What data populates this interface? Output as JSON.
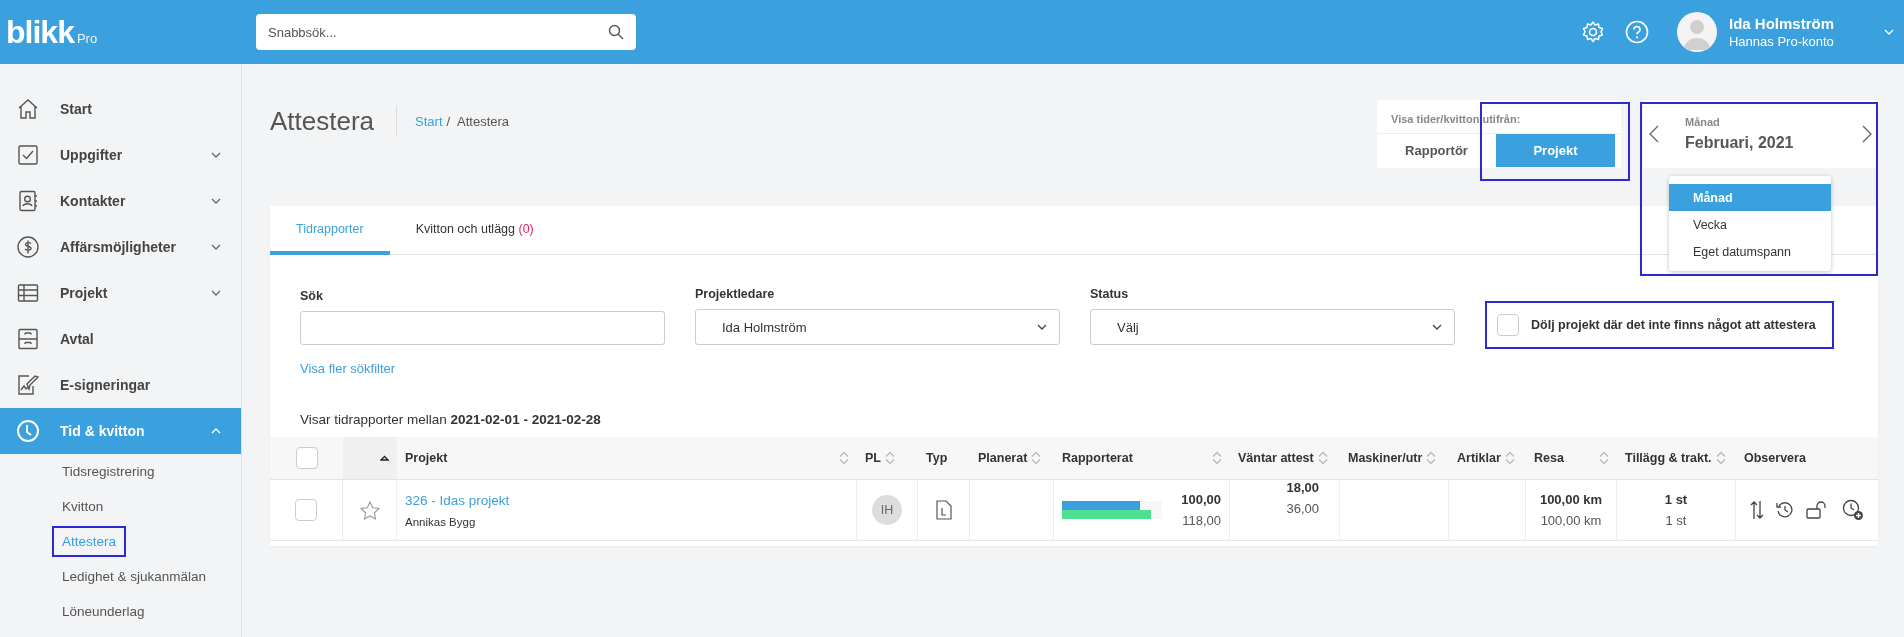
{
  "topbar": {
    "logo": "blikk",
    "logo_suffix": "Pro",
    "search": {
      "placeholder": "Snabbsök..."
    },
    "user": {
      "name": "Ida Holmström",
      "account": "Hannas Pro-konto"
    }
  },
  "sidebar": {
    "items": [
      {
        "label": "Start",
        "kind": "link",
        "selected": false
      },
      {
        "label": "Uppgifter",
        "kind": "group",
        "expanded": false,
        "selected": false
      },
      {
        "label": "Kontakter",
        "kind": "group",
        "expanded": false,
        "selected": false
      },
      {
        "label": "Affärsmöjligheter",
        "kind": "group",
        "expanded": false,
        "selected": false
      },
      {
        "label": "Projekt",
        "kind": "group",
        "expanded": false,
        "selected": false
      },
      {
        "label": "Avtal",
        "kind": "link",
        "selected": false
      },
      {
        "label": "E-signeringar",
        "kind": "link",
        "selected": false
      },
      {
        "label": "Tid & kvitton",
        "kind": "group",
        "expanded": true,
        "selected": true,
        "children": [
          {
            "label": "Tidsregistrering",
            "selected": false,
            "highlighted": false
          },
          {
            "label": "Kvitton",
            "selected": false,
            "highlighted": false
          },
          {
            "label": "Attestera",
            "selected": true,
            "highlighted": true
          },
          {
            "label": "Ledighet & sjukanmälan",
            "selected": false,
            "highlighted": false
          },
          {
            "label": "Löneunderlag",
            "selected": false,
            "highlighted": false
          }
        ]
      }
    ]
  },
  "page": {
    "title": "Attestera",
    "separator": "/",
    "breadcrumb": [
      {
        "label": "Start",
        "kind": "link"
      },
      {
        "label": "Attestera",
        "kind": "current"
      }
    ]
  },
  "view_toggle": {
    "label": "Visa tider/kvitton utifrån:",
    "highlighted": true,
    "options": [
      {
        "label": "Rapportör",
        "selected": false
      },
      {
        "label": "Projekt",
        "selected": true
      }
    ]
  },
  "period": {
    "label": "Månad",
    "value": "Februari, 2021",
    "highlighted": true,
    "options": [
      {
        "label": "Månad",
        "selected": true
      },
      {
        "label": "Vecka",
        "selected": false
      },
      {
        "label": "Eget datumspann",
        "selected": false
      }
    ]
  },
  "tabs": [
    {
      "label": "Tidrapporter",
      "selected": true
    },
    {
      "label": "Kvitton och utlägg",
      "count": "(0)",
      "selected": false
    }
  ],
  "filters": {
    "search": {
      "label": "Sök"
    },
    "project_manager": {
      "label": "Projektledare",
      "value": "Ida Holmström"
    },
    "status": {
      "label": "Status",
      "value": "Välj"
    },
    "hide_empty": {
      "label": "Dölj projekt där det inte finns något att attestera",
      "checked": false,
      "highlighted": true
    },
    "more_link": "Visa fler sökfilter"
  },
  "range_text": "Visar tidrapporter mellan **2021-02-01 - 2021-02-28**",
  "table": {
    "select_all": {
      "checked": false
    },
    "columns": [
      {
        "label": "Projekt",
        "sortable": true
      },
      {
        "label": "PL",
        "sortable": true
      },
      {
        "label": "Typ",
        "sortable": false
      },
      {
        "label": "Planerat",
        "sortable": true
      },
      {
        "label": "Rapporterat",
        "sortable": true
      },
      {
        "label": "Väntar attest",
        "sortable": true
      },
      {
        "label": "Maskiner/utr",
        "sortable": true
      },
      {
        "label": "Artiklar",
        "sortable": true
      },
      {
        "label": "Resa",
        "sortable": true
      },
      {
        "label": "Tillägg & trakt.",
        "sortable": true
      },
      {
        "label": "Observera",
        "sortable": false
      }
    ],
    "rows": [
      {
        "checked": false,
        "starred": false,
        "project": "326 - Idas projekt",
        "customer": "Annikas Bygg",
        "pl": "IH",
        "bars": [
          {
            "level": 0.78,
            "color": "#3aa0de"
          },
          {
            "level": 0.89,
            "color": "#4fe08f"
          }
        ],
        "reported": [
          "100,00",
          "118,00"
        ],
        "waiting": [
          "18,00",
          "36,00"
        ],
        "travel": [
          "100,00 km",
          "100,00 km"
        ],
        "extras": [
          "1 st",
          "1 st"
        ]
      }
    ]
  }
}
